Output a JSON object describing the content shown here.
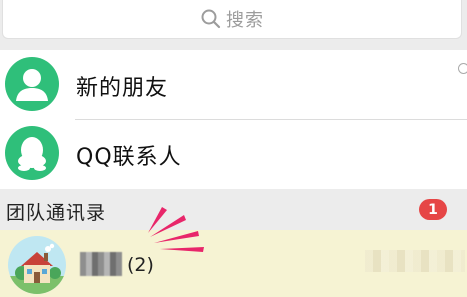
{
  "search": {
    "placeholder": "搜索",
    "icon": "search-icon"
  },
  "contacts": {
    "items": [
      {
        "label": "新的朋友",
        "icon": "person-icon",
        "color": "#2fbf7a"
      },
      {
        "label": "QQ联系人",
        "icon": "qq-penguin-icon",
        "color": "#2fbf7a"
      }
    ]
  },
  "team_section": {
    "title": "团队通讯录",
    "badge": "1",
    "badge_color": "#e64646"
  },
  "group": {
    "count": "(2)",
    "icon": "house-icon",
    "highlight_color": "#f6f3d3"
  },
  "annotation": {
    "color": "#e8266a"
  }
}
